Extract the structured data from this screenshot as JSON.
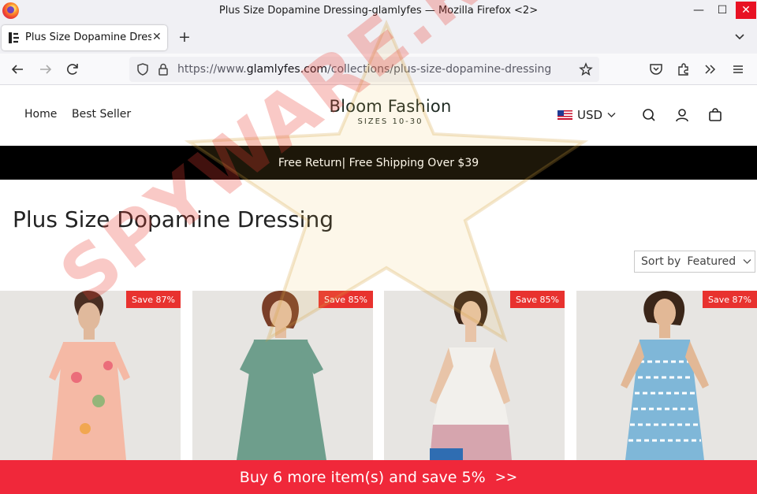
{
  "window": {
    "title": "Plus Size Dopamine Dressing-glamlyfes — Mozilla Firefox <2>",
    "minimize_glyph": "—",
    "maximize_glyph": "☐",
    "close_glyph": "✕"
  },
  "tabs": [
    {
      "label": "Plus Size Dopamine Dressing-glamlyfes",
      "close_glyph": "✕"
    }
  ],
  "browser": {
    "new_tab_glyph": "+",
    "url_scheme": "https://www.",
    "url_host": "glamlyfes.com",
    "url_path": "/collections/plus-size-dopamine-dressing",
    "icons": [
      "back-icon",
      "forward-icon",
      "reload-icon",
      "shield-icon",
      "lock-icon",
      "bookmark-star-icon",
      "pocket-icon",
      "extensions-icon",
      "overflow-icon",
      "menu-icon",
      "tab-list-icon"
    ]
  },
  "site": {
    "nav": {
      "home": "Home",
      "best_seller": "Best Seller"
    },
    "brand": {
      "name": "Bloom Fashion",
      "tagline": "SIZES 10-30"
    },
    "currency": "USD",
    "icons": [
      "us-flag-icon",
      "search-icon",
      "account-icon",
      "cart-icon"
    ]
  },
  "announcement": "Free Return| Free Shipping Over $39",
  "collection": {
    "title": "Plus Size Dopamine Dressing",
    "sort_label": "Sort by",
    "sort_value": "Featured"
  },
  "products": [
    {
      "badge": "Save 87%",
      "dress_color": "#f5b9a5"
    },
    {
      "badge": "Save 85%",
      "dress_color": "#6e9e8c"
    },
    {
      "badge": "Save 85%",
      "dress_color": "#f2f0ec"
    },
    {
      "badge": "Save 87%",
      "dress_color": "#7fb7d8"
    }
  ],
  "promo": {
    "text": "Buy 6 more item(s) and save 5%",
    "arrow": ">>"
  },
  "watermark": "SPYWARE.RU",
  "colors": {
    "announcement_bg": "#000000",
    "promo_bg": "#f0283a",
    "badge_bg": "#e8322f",
    "close_button": "#e81123"
  }
}
